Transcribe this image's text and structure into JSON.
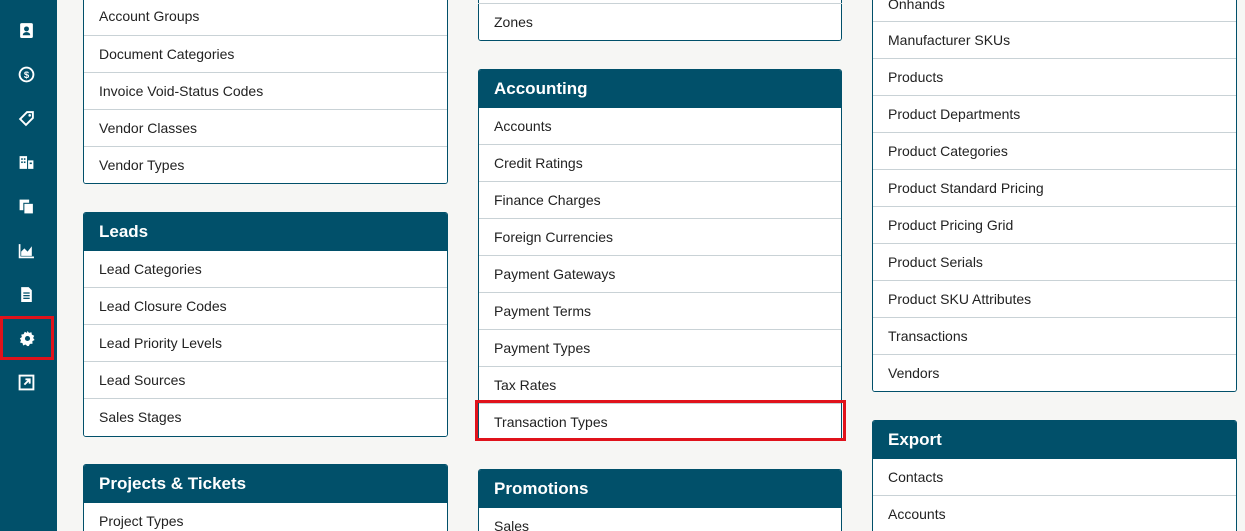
{
  "sidebar": {
    "icons": [
      "contacts-icon",
      "dollar-icon",
      "tag-icon",
      "buildings-icon",
      "documents-icon",
      "chart-icon",
      "file-text-icon",
      "gear-icon",
      "external-link-icon"
    ],
    "active": "gear-icon"
  },
  "col1": {
    "top_items": [
      "Account Groups",
      "Document Categories",
      "Invoice Void-Status Codes",
      "Vendor Classes",
      "Vendor Types"
    ],
    "leads": {
      "title": "Leads",
      "items": [
        "Lead Categories",
        "Lead Closure Codes",
        "Lead Priority Levels",
        "Lead Sources",
        "Sales Stages"
      ]
    },
    "projects": {
      "title": "Projects & Tickets",
      "items": [
        "Project Types"
      ]
    }
  },
  "col2": {
    "top_items": [
      "Zones"
    ],
    "accounting": {
      "title": "Accounting",
      "items": [
        "Accounts",
        "Credit Ratings",
        "Finance Charges",
        "Foreign Currencies",
        "Payment Gateways",
        "Payment Terms",
        "Payment Types",
        "Tax Rates",
        "Transaction Types"
      ]
    },
    "promotions": {
      "title": "Promotions",
      "items": [
        "Sales"
      ]
    }
  },
  "col3": {
    "top_items": [
      "Onhands",
      "Manufacturer SKUs",
      "Products",
      "Product Departments",
      "Product Categories",
      "Product Standard Pricing",
      "Product Pricing Grid",
      "Product Serials",
      "Product SKU Attributes",
      "Transactions",
      "Vendors"
    ],
    "export": {
      "title": "Export",
      "items": [
        "Contacts",
        "Accounts"
      ]
    }
  },
  "colors": {
    "header": "#01506a",
    "highlight": "#e0121b"
  }
}
